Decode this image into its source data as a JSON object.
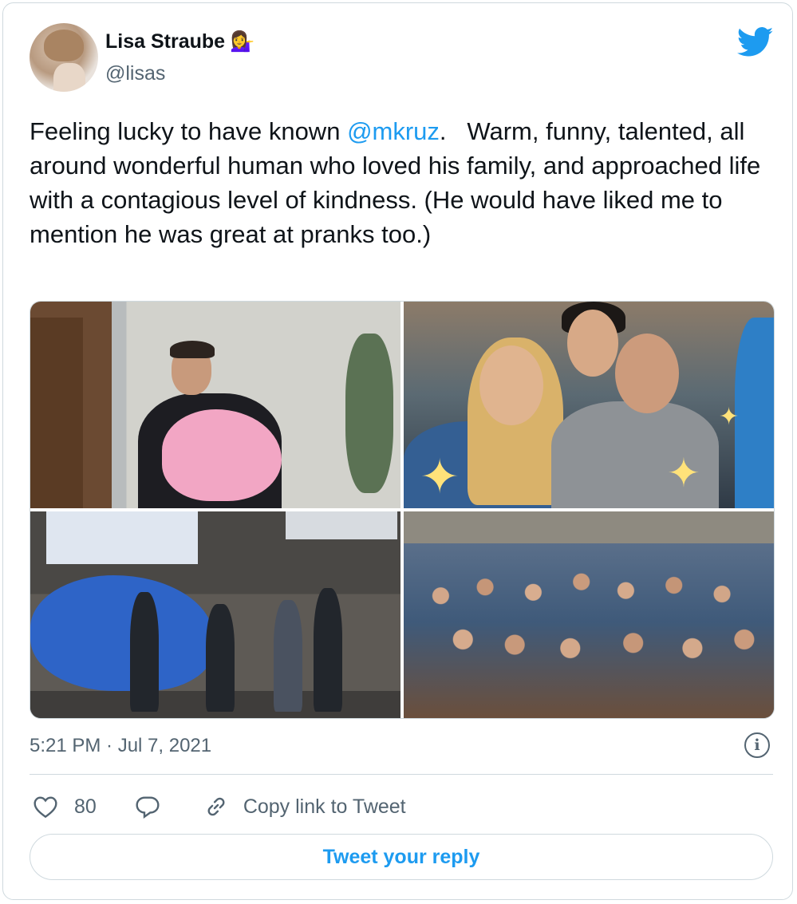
{
  "author": {
    "display_name": "Lisa Straube",
    "name_emoji": "💁‍♀️",
    "handle": "@lisas"
  },
  "tweet": {
    "text_before_mention": "Feeling lucky to have known ",
    "mention": "@mkruz",
    "text_after_mention": ".   Warm, funny, talented, all around wonderful human who loved his family, and approached life with a contagious level of kindness. (He would have liked me to mention he was great at pranks too.)",
    "timestamp": "5:21 PM · Jul 7, 2021"
  },
  "media": {
    "photo_count": 4
  },
  "actions": {
    "like_count": "80",
    "copy_link_label": "Copy link to Tweet"
  },
  "reply_button_label": "Tweet your reply",
  "colors": {
    "accent": "#1d9bf0",
    "text": "#0f1419",
    "secondary_text": "#536471",
    "border": "#cfd9de"
  },
  "icons": {
    "logo": "twitter-bird-icon",
    "info": "info-icon",
    "like": "heart-icon",
    "reply": "reply-bubble-icon",
    "copy_link": "link-icon"
  }
}
